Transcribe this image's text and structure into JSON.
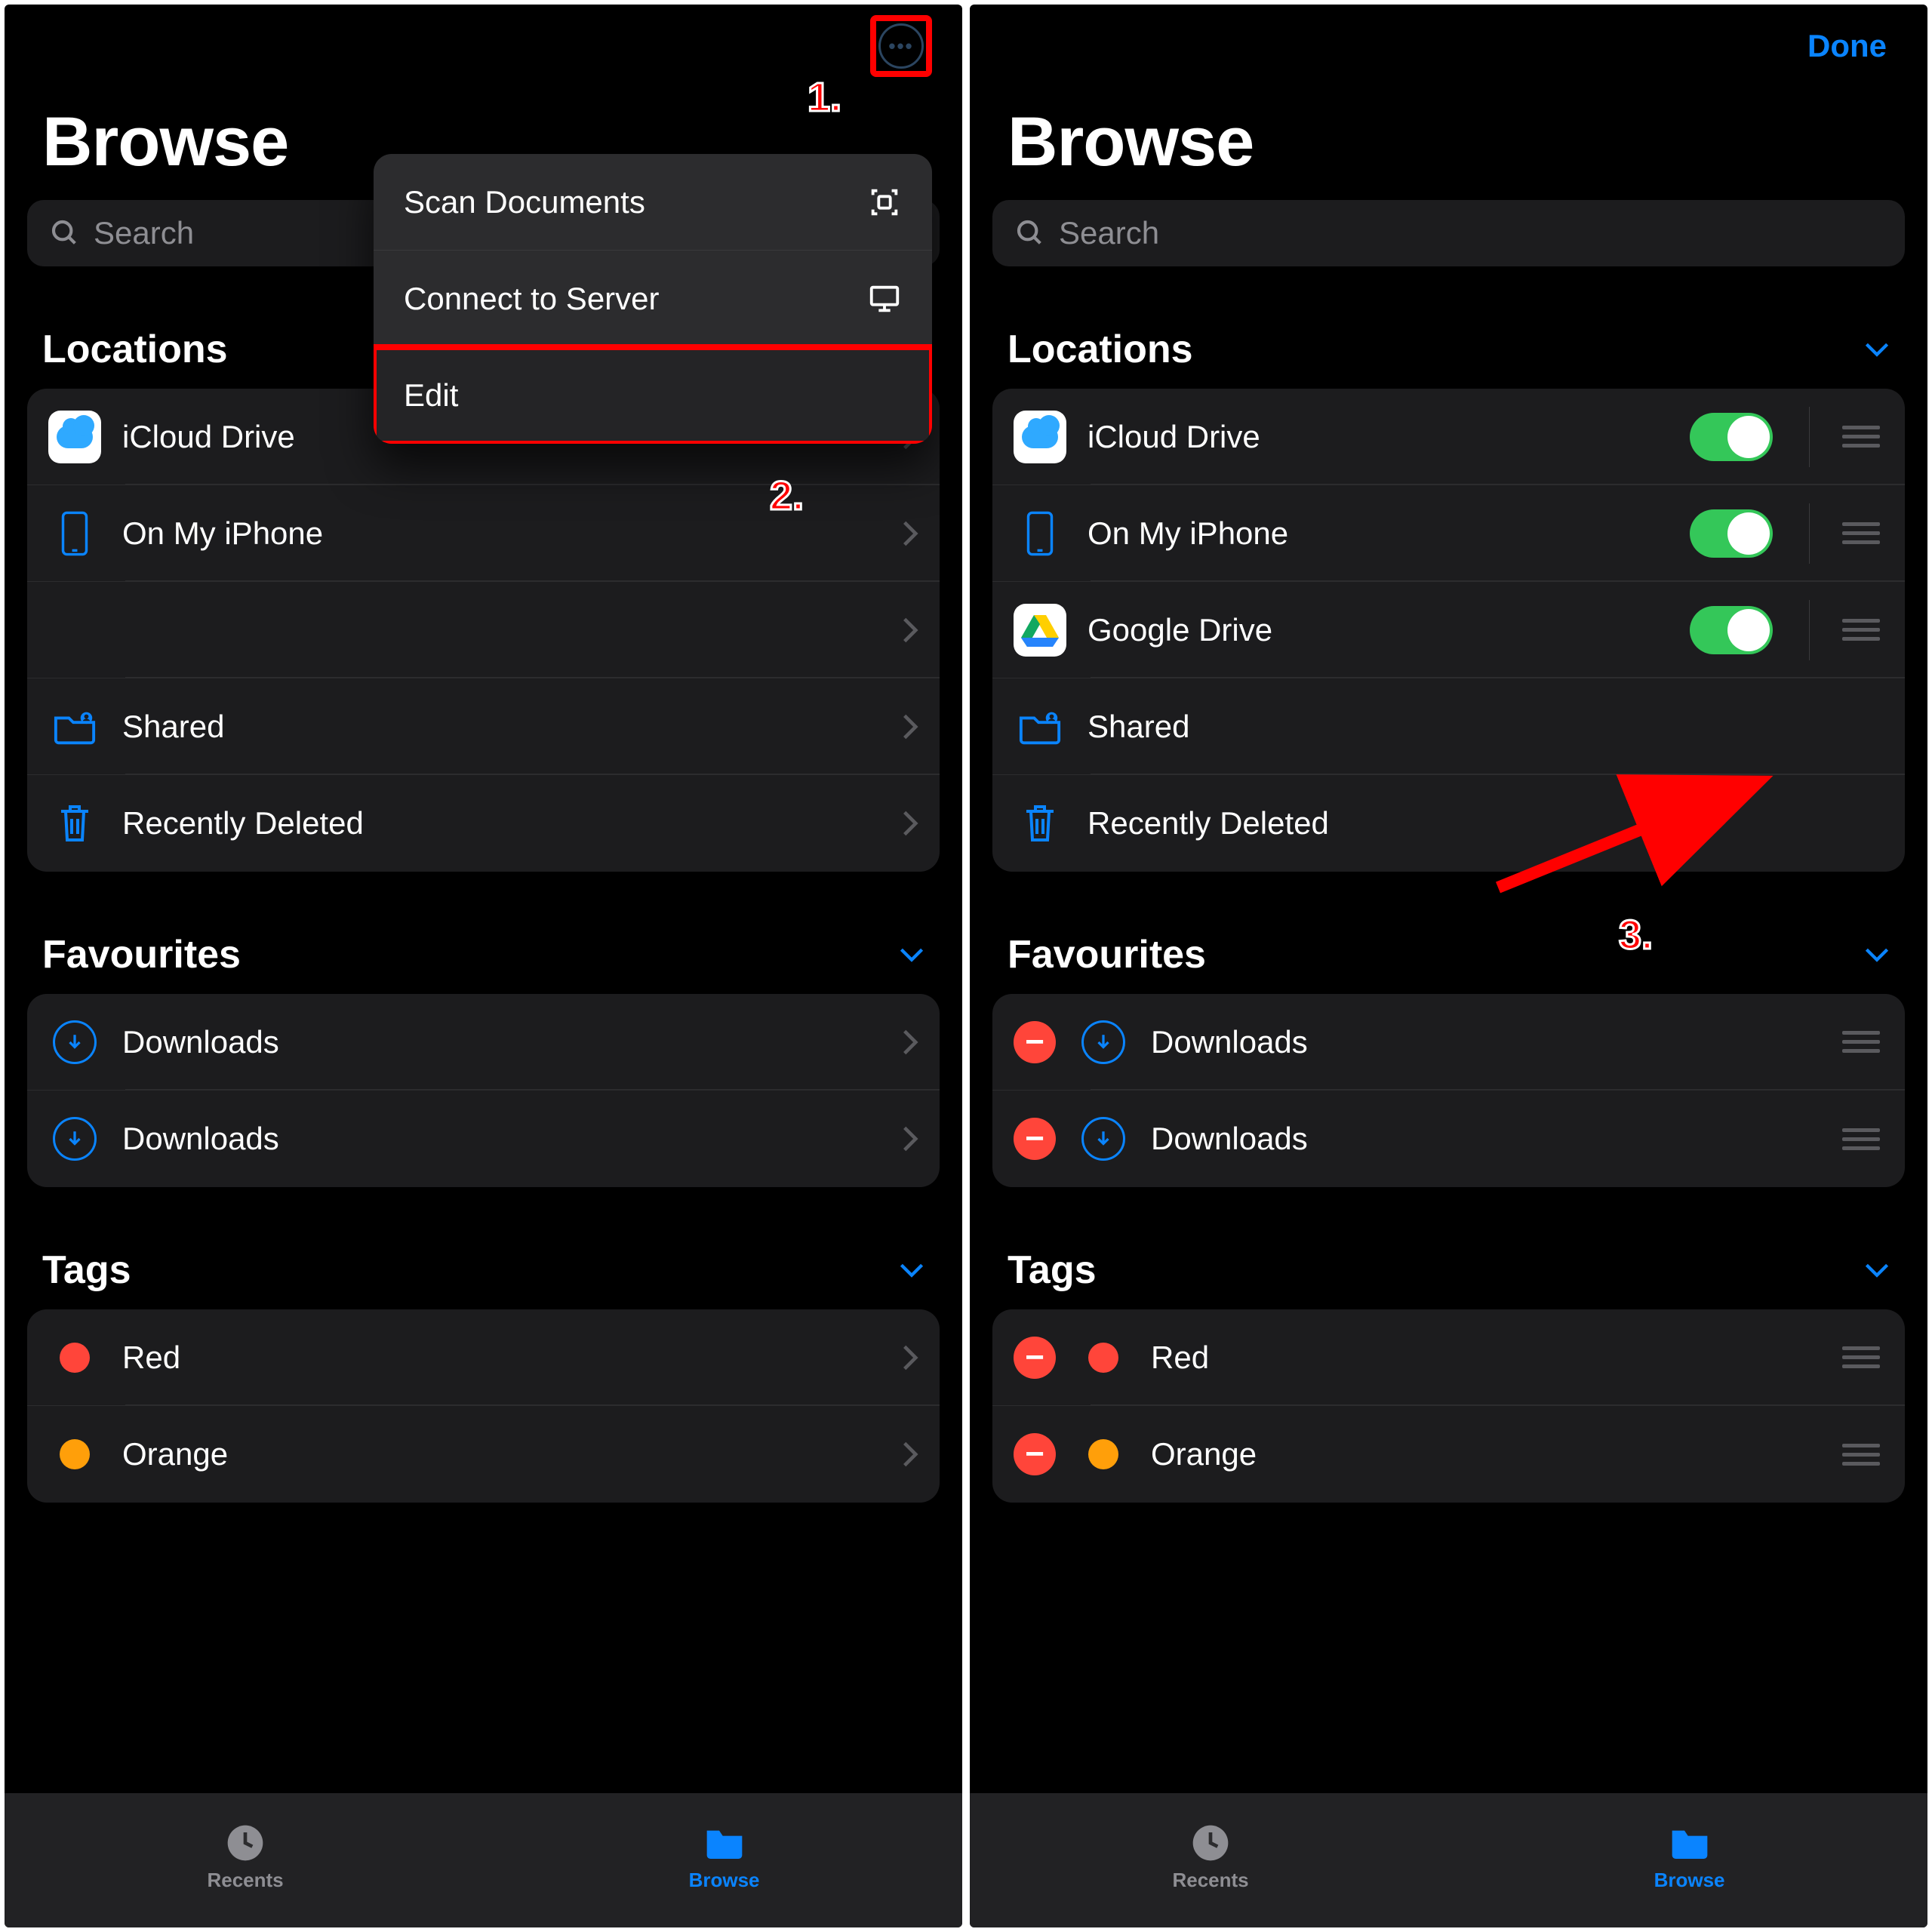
{
  "common": {
    "title": "Browse",
    "search_placeholder": "Search",
    "sections": {
      "locations": "Locations",
      "favourites": "Favourites",
      "tags": "Tags"
    },
    "tabs": {
      "recents": "Recents",
      "browse": "Browse"
    }
  },
  "left": {
    "more_menu": {
      "scan": "Scan Documents",
      "connect": "Connect to Server",
      "edit": "Edit"
    },
    "locations": {
      "icloud": "iCloud Drive",
      "on_iphone": "On My iPhone",
      "blank": "",
      "shared": "Shared",
      "deleted": "Recently Deleted"
    },
    "favourites": {
      "dl1": "Downloads",
      "dl2": "Downloads"
    },
    "tags": {
      "red": "Red",
      "orange": "Orange"
    }
  },
  "right": {
    "done": "Done",
    "locations": {
      "icloud": "iCloud Drive",
      "on_iphone": "On My iPhone",
      "gdrive": "Google Drive",
      "shared": "Shared",
      "deleted": "Recently Deleted"
    },
    "favourites": {
      "dl1": "Downloads",
      "dl2": "Downloads"
    },
    "tags": {
      "red": "Red",
      "orange": "Orange"
    }
  },
  "annot": {
    "one": "1.",
    "two": "2.",
    "three": "3."
  },
  "colors": {
    "accent": "#0a84ff",
    "toggle_on": "#34c759",
    "annotation": "#ff0000",
    "tag_red": "#ff453a",
    "tag_orange": "#ff9f0a"
  }
}
